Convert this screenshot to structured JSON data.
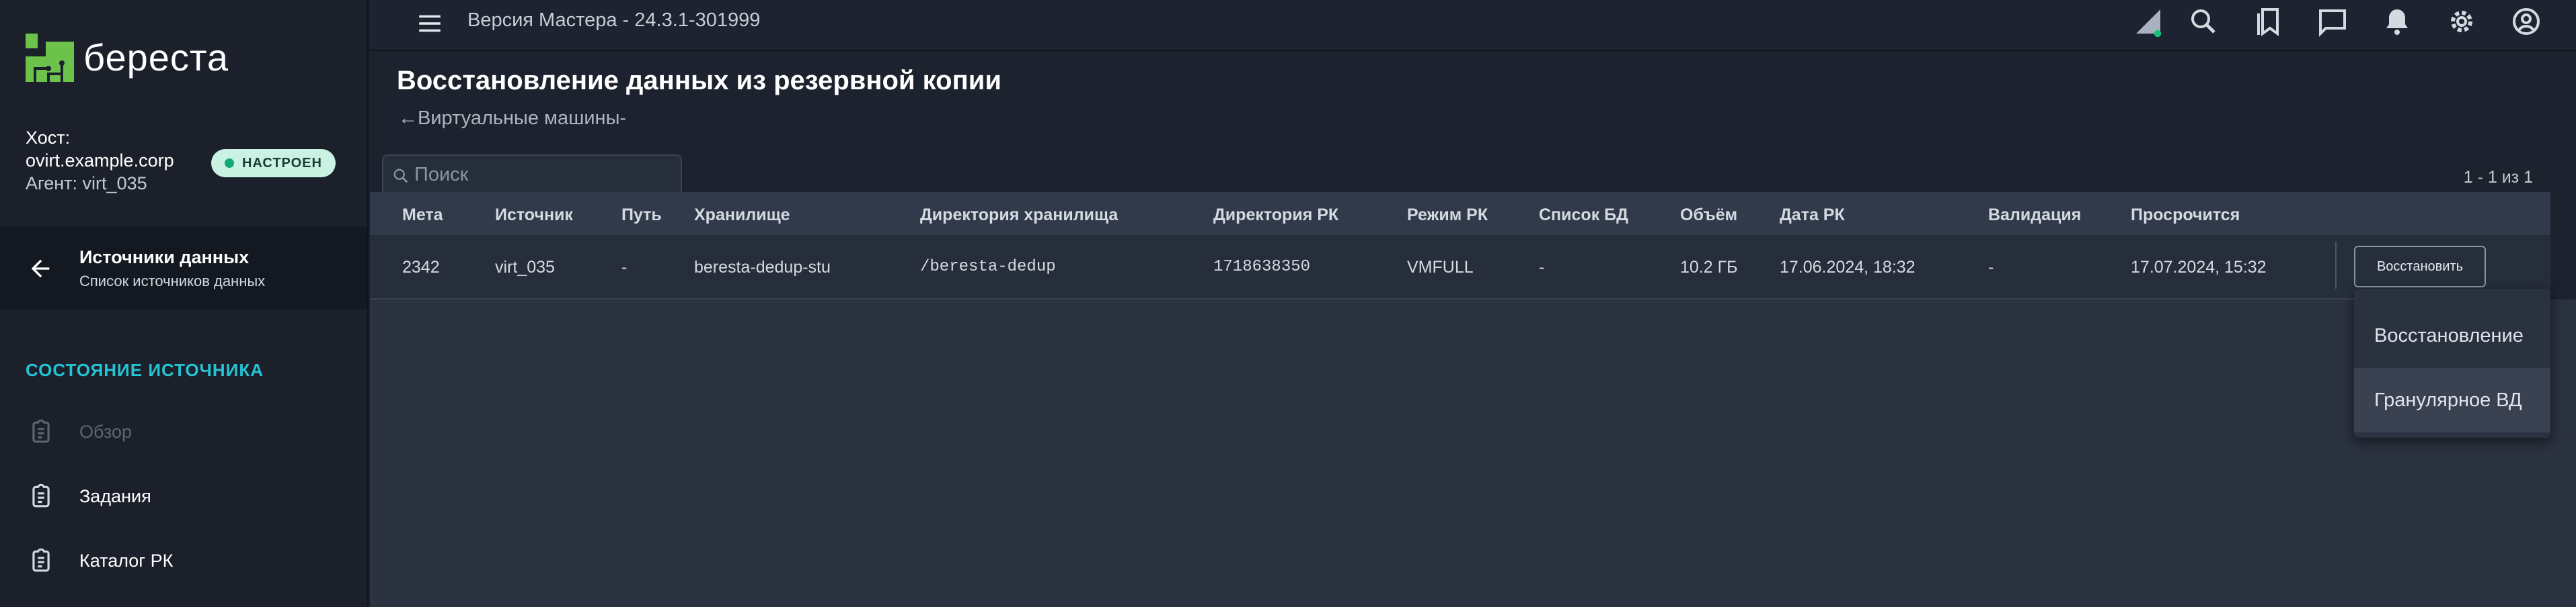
{
  "sidebar": {
    "brand": "береста",
    "host_label": "Хост:",
    "host_name": "ovirt.example.corp",
    "agent": "Агент: virt_035",
    "status_badge": "НАСТРОЕН",
    "nav_back_title": "Источники данных",
    "nav_back_subtitle": "Список источников данных",
    "section_title": "СОСТОЯНИЕ ИСТОЧНИКА",
    "items": [
      {
        "label": "Обзор",
        "icon": "clipboard-icon",
        "disabled": true
      },
      {
        "label": "Задания",
        "icon": "clipboard-icon",
        "disabled": false
      },
      {
        "label": "Каталог РК",
        "icon": "clipboard-icon",
        "disabled": false
      }
    ]
  },
  "topbar": {
    "version": "Версия Мастера - 24.3.1-301999",
    "icons": [
      "signal-icon",
      "search-icon",
      "bookmarks-icon",
      "chat-icon",
      "bell-icon",
      "gear-icon",
      "account-icon"
    ]
  },
  "main": {
    "title": "Восстановление данных из резервной копии",
    "breadcrumb": "←Виртуальные машины-",
    "search_placeholder": "Поиск",
    "pager": "1 - 1 из 1",
    "columns": [
      "Мета",
      "Источник",
      "Путь",
      "Хранилище",
      "Директория хранилища",
      "Директория РК",
      "Режим РК",
      "Список БД",
      "Объём",
      "Дата РК",
      "Валидация",
      "Просрочится"
    ],
    "rows": [
      [
        "2342",
        "virt_035",
        "-",
        "beresta-dedup-stu",
        "/beresta-dedup",
        "1718638350",
        "VMFULL",
        "-",
        "10.2 ГБ",
        "17.06.2024, 18:32",
        "-",
        "17.07.2024, 15:32"
      ]
    ],
    "restore_button": "Восстановить",
    "dropdown": [
      "Восстановление",
      "Гранулярное ВД"
    ]
  },
  "colors": {
    "accent": "#24c4d4",
    "brand_green": "#6cc24a",
    "badge_bg": "#c9f2e2",
    "badge_dot": "#11a87a",
    "status_dot": "#19c27a"
  }
}
